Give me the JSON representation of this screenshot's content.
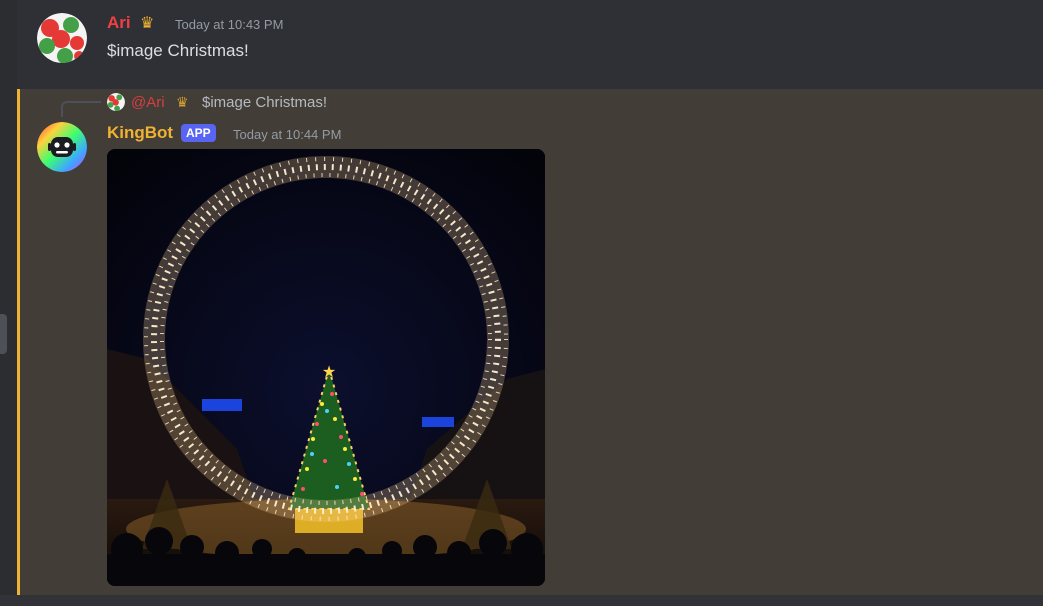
{
  "messages": [
    {
      "author": "Ari",
      "author_color": "#f23f43",
      "badge_icon": "crown-icon",
      "timestamp": "Today at 10:43 PM",
      "content": "$image Christmas!"
    },
    {
      "reply": {
        "author": "@Ari",
        "badge_icon": "crown-icon",
        "content": "$image Christmas!"
      },
      "author": "KingBot",
      "author_color": "#f0b232",
      "tag": "APP",
      "timestamp": "Today at 10:44 PM",
      "attachment": "christmas-tree-light-arch-image"
    }
  ],
  "colors": {
    "background": "#313338",
    "mention_highlight": "#423d37",
    "mention_bar": "#f0b232",
    "app_badge": "#5865f2"
  }
}
